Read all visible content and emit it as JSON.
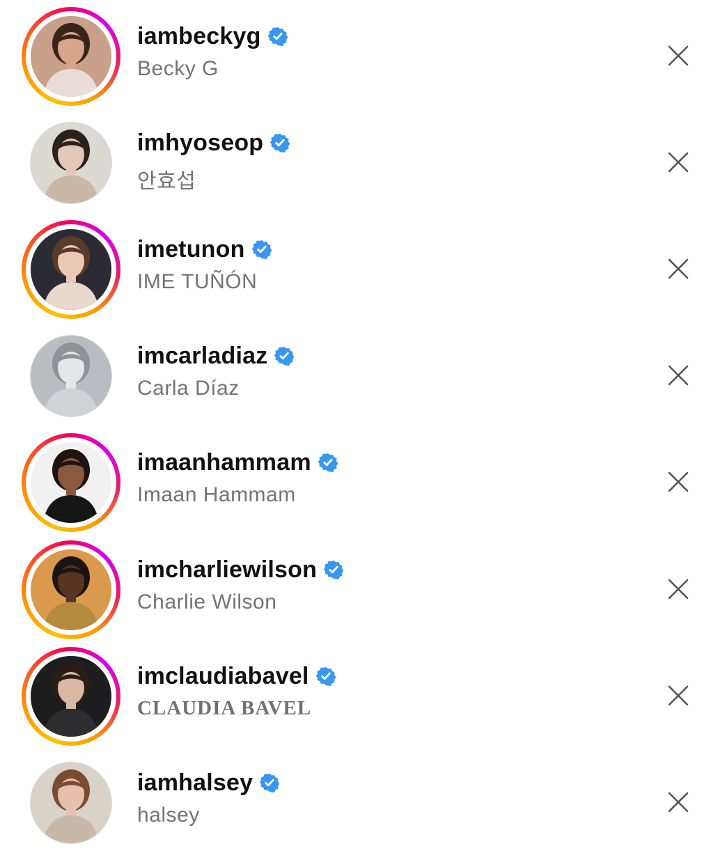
{
  "suggestions": [
    {
      "username": "iambeckyg",
      "full_name": "Becky G",
      "verified": true,
      "has_story": true,
      "avatar": {
        "bg": "#c9a089",
        "skin": "#d6a58a",
        "hair": "#3a2418",
        "clothes": "#e9dcd6"
      }
    },
    {
      "username": "imhyoseop",
      "full_name": "안효섭",
      "verified": true,
      "has_story": false,
      "avatar": {
        "bg": "#dcd8d2",
        "skin": "#e3c8b5",
        "hair": "#2a211c",
        "clothes": "#c9b8a6"
      }
    },
    {
      "username": "imetunon",
      "full_name": "IME TUÑÓN",
      "verified": true,
      "has_story": true,
      "avatar": {
        "bg": "#2b2c33",
        "skin": "#ecc9b5",
        "hair": "#5a3a28",
        "clothes": "#e8d9cc"
      }
    },
    {
      "username": "imcarladiaz",
      "full_name": "Carla Díaz",
      "verified": true,
      "has_story": false,
      "avatar": {
        "bg": "#b9bcc0",
        "skin": "#e4e6e8",
        "hair": "#8f9398",
        "clothes": "#d0d3d6"
      }
    },
    {
      "username": "imaanhammam",
      "full_name": "Imaan Hammam",
      "verified": true,
      "has_story": true,
      "avatar": {
        "bg": "#f1f1f1",
        "skin": "#8b5a3c",
        "hair": "#1e1410",
        "clothes": "#151515"
      }
    },
    {
      "username": "imcharliewilson",
      "full_name": "Charlie Wilson",
      "verified": true,
      "has_story": true,
      "avatar": {
        "bg": "#d99a4e",
        "skin": "#5a3422",
        "hair": "#1b1410",
        "clothes": "#b58b3f"
      }
    },
    {
      "username": "imclaudiabavel",
      "full_name": "CLAUDIA BAVEL",
      "verified": true,
      "has_story": true,
      "full_name_style": "serif",
      "avatar": {
        "bg": "#1d1d1f",
        "skin": "#d9b8a4",
        "hair": "#2a1d16",
        "clothes": "#2e2e30"
      }
    },
    {
      "username": "iamhalsey",
      "full_name": "halsey",
      "verified": true,
      "has_story": false,
      "avatar": {
        "bg": "#d9d2c8",
        "skin": "#e5c1ad",
        "hair": "#7a4a33",
        "clothes": "#c8b8a8"
      }
    }
  ],
  "icons": {
    "verified": "verified-badge-icon",
    "remove": "close-icon"
  },
  "colors": {
    "verified_blue": "#3897f0",
    "username": "#111111",
    "full_name": "#737373",
    "close_icon": "#555555"
  }
}
